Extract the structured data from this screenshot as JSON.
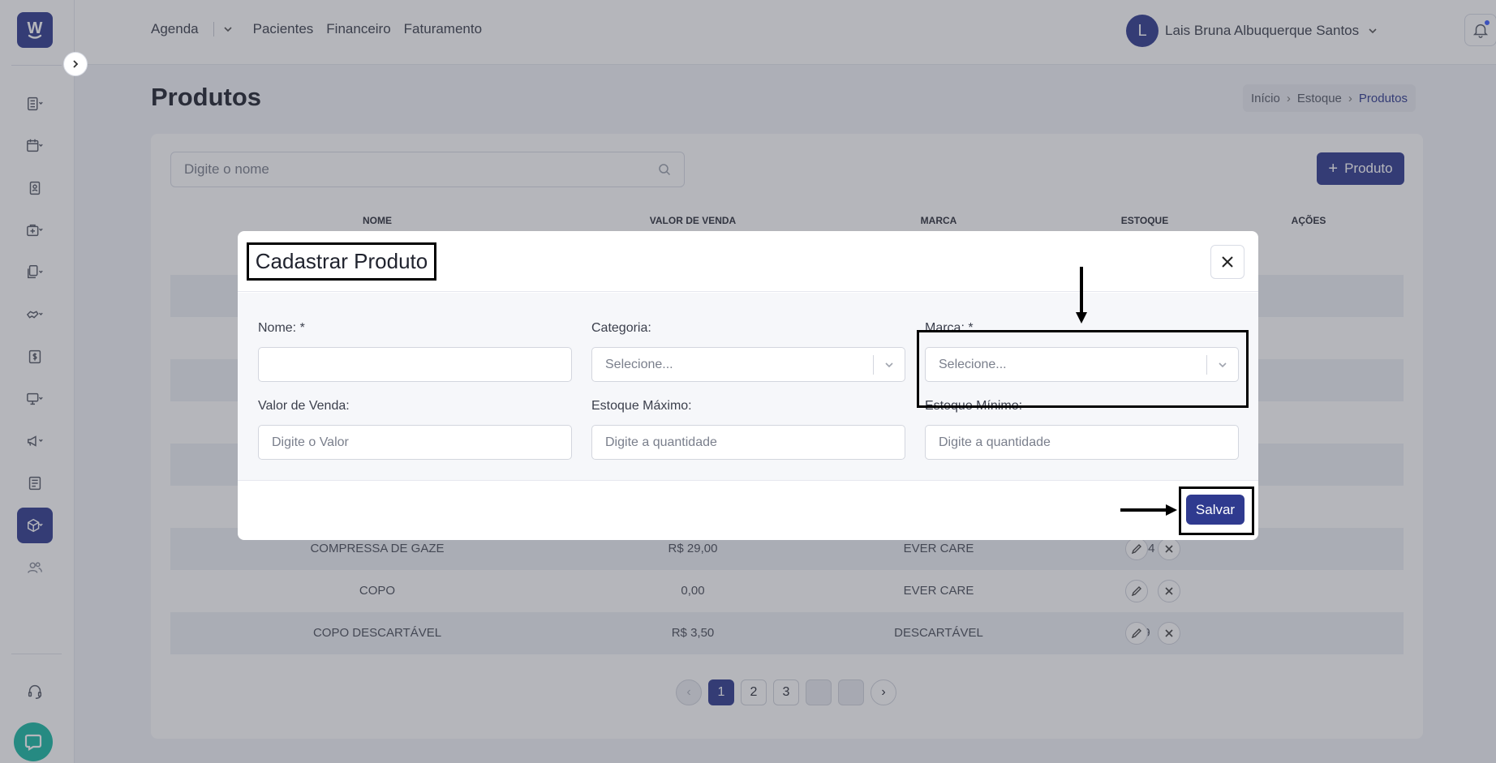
{
  "app": {
    "logo_letter": "W",
    "brand_color": "#2f3a8f"
  },
  "sidebar": {
    "items": [
      {
        "icon": "clipboard-list-icon"
      },
      {
        "icon": "calendar-icon"
      },
      {
        "icon": "contact-card-icon"
      },
      {
        "icon": "medical-bag-icon"
      },
      {
        "icon": "documents-icon"
      },
      {
        "icon": "handshake-icon"
      },
      {
        "icon": "dollar-icon"
      },
      {
        "icon": "monitor-icon"
      },
      {
        "icon": "megaphone-icon"
      },
      {
        "icon": "newspaper-icon"
      },
      {
        "icon": "box-icon",
        "active": true
      },
      {
        "icon": "users-icon"
      }
    ],
    "support_icon": "headset-icon",
    "chat_icon": "chat-bubble-icon"
  },
  "topnav": {
    "agenda": "Agenda",
    "pacientes": "Pacientes",
    "financeiro": "Financeiro",
    "faturamento": "Faturamento"
  },
  "user": {
    "initial": "L",
    "name": "Lais Bruna Albuquerque Santos"
  },
  "page": {
    "title": "Produtos",
    "breadcrumb": [
      "Início",
      "Estoque",
      "Produtos"
    ]
  },
  "toolbar": {
    "search_placeholder": "Digite o nome",
    "add_label": "Produto"
  },
  "table": {
    "headers": [
      "NOME",
      "VALOR DE VENDA",
      "MARCA",
      "ESTOQUE",
      "AÇÕES"
    ],
    "rows": [
      {
        "nome": "",
        "valor": "",
        "marca": "",
        "estoque": ""
      },
      {
        "nome": "",
        "valor": "",
        "marca": "",
        "estoque": ""
      },
      {
        "nome": "",
        "valor": "",
        "marca": "",
        "estoque": ""
      },
      {
        "nome": "",
        "valor": "",
        "marca": "",
        "estoque": ""
      },
      {
        "nome": "",
        "valor": "",
        "marca": "",
        "estoque": ""
      },
      {
        "nome": "",
        "valor": "",
        "marca": "",
        "estoque": ""
      },
      {
        "nome": "",
        "valor": "",
        "marca": "",
        "estoque": ""
      },
      {
        "nome": "COMPRESSA DE GAZE",
        "valor": "R$ 29,00",
        "marca": "EVER CARE",
        "estoque": "384"
      },
      {
        "nome": "COPO",
        "valor": "0,00",
        "marca": "EVER CARE",
        "estoque": ""
      },
      {
        "nome": "COPO DESCARTÁVEL",
        "valor": "R$ 3,50",
        "marca": "DESCARTÁVEL",
        "estoque": "-9"
      }
    ]
  },
  "pagination": {
    "pages": [
      "1",
      "2",
      "3",
      "",
      ""
    ],
    "current": "1"
  },
  "modal": {
    "title": "Cadastrar Produto",
    "fields": {
      "nome": {
        "label": "Nome: *",
        "value": ""
      },
      "categoria": {
        "label": "Categoria:",
        "placeholder": "Selecione..."
      },
      "marca": {
        "label": "Marca: *",
        "placeholder": "Selecione..."
      },
      "valor_venda": {
        "label": "Valor de Venda:",
        "placeholder": "Digite o Valor"
      },
      "estoque_maximo": {
        "label": "Estoque Máximo:",
        "placeholder": "Digite a quantidade"
      },
      "estoque_minimo": {
        "label": "Estoque Mínimo:",
        "placeholder": "Digite a quantidade"
      }
    },
    "save_label": "Salvar"
  }
}
